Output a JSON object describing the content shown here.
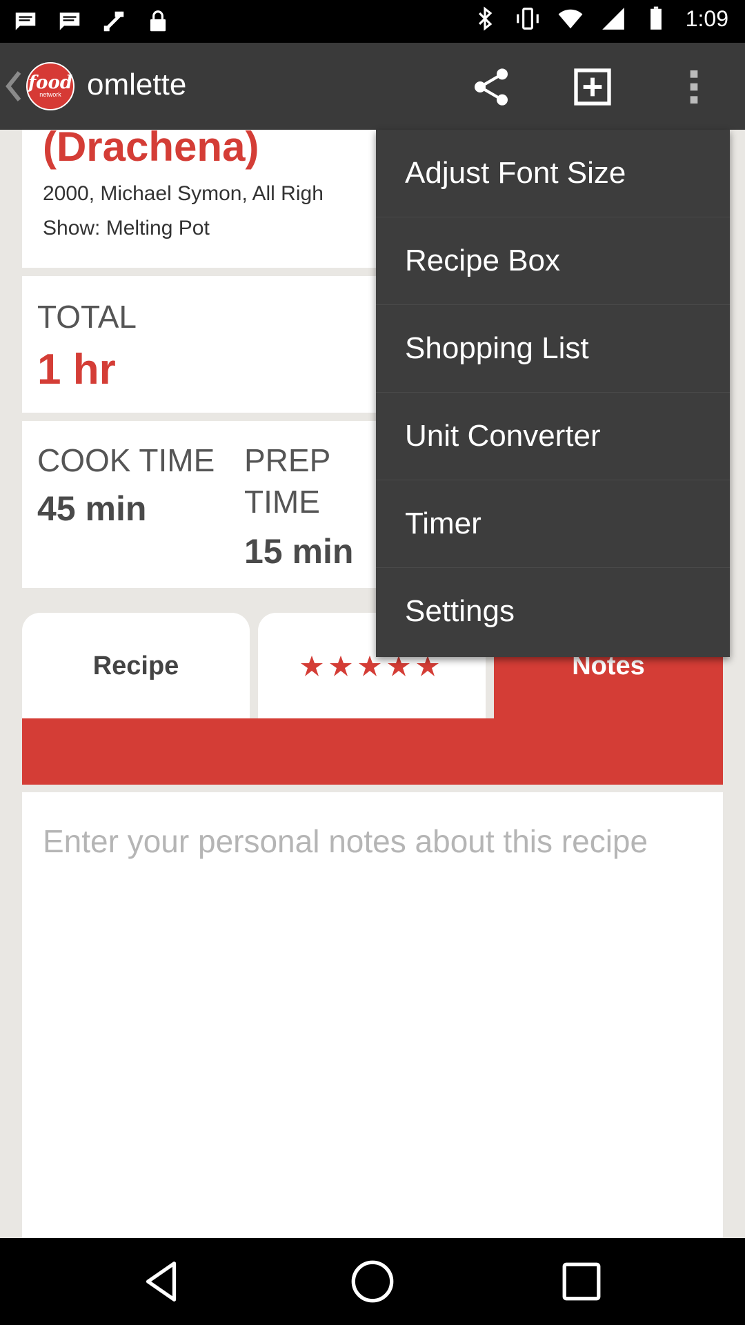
{
  "status_bar": {
    "time": "1:09",
    "left_icons": [
      "message-icon",
      "message-icon",
      "fake-gps-icon",
      "lock-icon"
    ],
    "right_icons": [
      "bluetooth-icon",
      "vibrate-icon",
      "wifi-icon",
      "signal-icon",
      "battery-icon"
    ]
  },
  "app_bar": {
    "logo_word": "food",
    "logo_sub": "network",
    "title": "omlette",
    "actions": [
      "share-icon",
      "add-box-icon",
      "overflow-menu-icon"
    ]
  },
  "recipe": {
    "title": "(Drachena)",
    "credit_line1": "2000, Michael Symon, All Righ",
    "credit_line2": "Show: Melting Pot",
    "total_label": "TOTAL",
    "total_value": "1 hr",
    "cook_label": "COOK TIME",
    "cook_value": "45 min",
    "prep_label_1": "PREP",
    "prep_label_2": "TIME",
    "prep_value": "15 min"
  },
  "tabs": {
    "recipe": "Recipe",
    "reviews_stars": 5,
    "notes": "Notes"
  },
  "notes": {
    "placeholder": "Enter your personal notes about this recipe"
  },
  "menu": {
    "items": [
      "Adjust Font Size",
      "Recipe Box",
      "Shopping List",
      "Unit Converter",
      "Timer",
      "Settings"
    ]
  },
  "colors": {
    "accent": "#d43d36",
    "appbar": "#3a3a3a",
    "menu_bg": "#3d3d3d",
    "page_bg": "#e9e7e3"
  }
}
